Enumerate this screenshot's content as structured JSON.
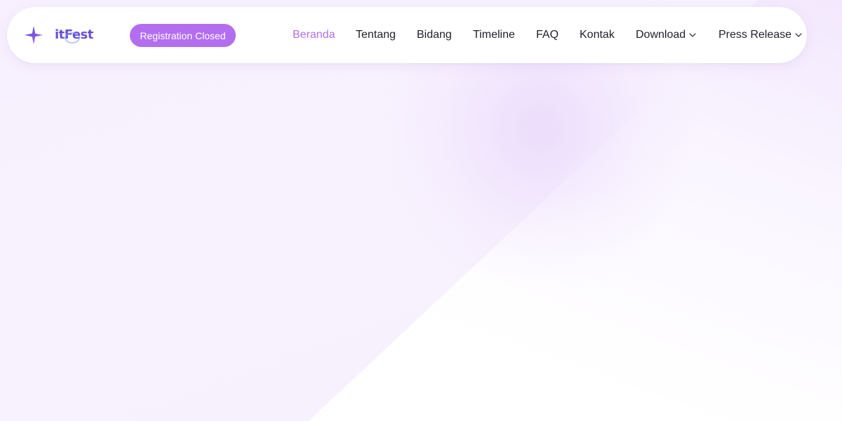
{
  "brand": {
    "logo_text": "itFest",
    "icon": "sparkle-star-icon"
  },
  "registration": {
    "label": "Registration Closed",
    "color": "#b36ef0"
  },
  "nav": {
    "items": [
      {
        "label": "Beranda",
        "active": true
      },
      {
        "label": "Tentang"
      },
      {
        "label": "Bidang"
      },
      {
        "label": "Timeline"
      },
      {
        "label": "FAQ"
      },
      {
        "label": "Kontak"
      },
      {
        "label": "Download",
        "dropdown": true,
        "icon": "chevron-down-icon"
      },
      {
        "label": "Press Release",
        "dropdown": true,
        "icon": "chevron-down-icon"
      }
    ]
  },
  "colors": {
    "accent": "#b46ee8",
    "text": "#1f1f2b",
    "background": "#f9f4fe"
  }
}
